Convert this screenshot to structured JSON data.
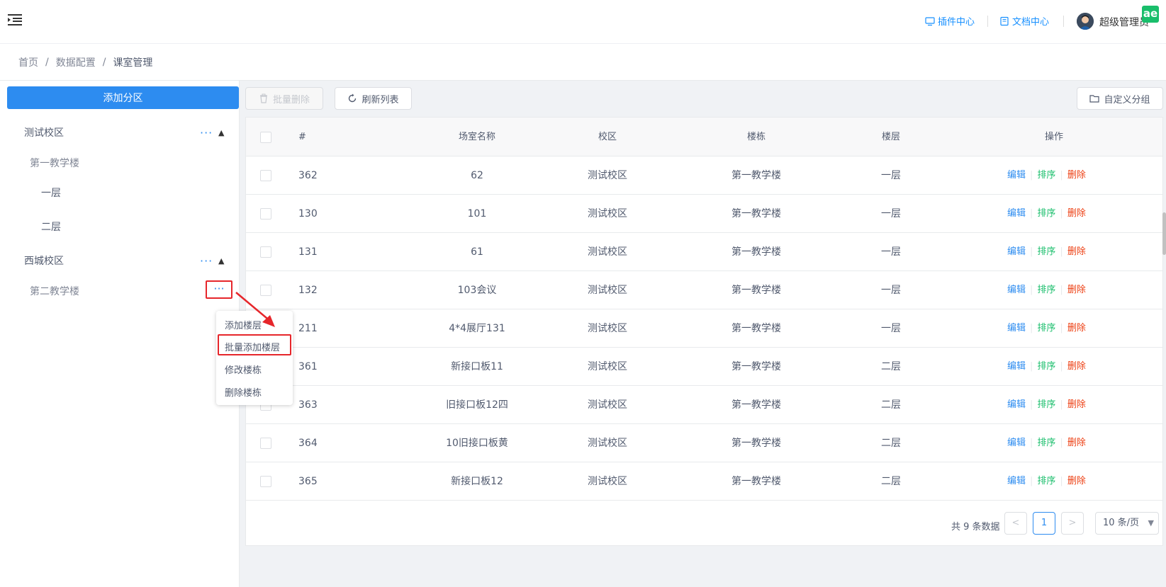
{
  "header": {
    "plugin_center": "插件中心",
    "doc_center": "文档中心",
    "user_name": "超级管理员",
    "corner_badge": "ae"
  },
  "breadcrumb": [
    "首页",
    "数据配置",
    "课室管理"
  ],
  "sidebar": {
    "add_zone_label": "添加分区",
    "more_glyph": "···",
    "tree": [
      {
        "label": "测试校区",
        "level": 0
      },
      {
        "label": "第一教学楼",
        "level": 1
      },
      {
        "label": "一层",
        "level": 2
      },
      {
        "label": "二层",
        "level": 2
      },
      {
        "label": "西城校区",
        "level": 0
      },
      {
        "label": "第二教学楼",
        "level": 1
      }
    ]
  },
  "dropdown": {
    "items": [
      "添加楼层",
      "批量添加楼层",
      "修改楼栋",
      "删除楼栋"
    ]
  },
  "toolbar": {
    "batch_delete": "批量删除",
    "refresh": "刷新列表",
    "custom_group": "自定义分组"
  },
  "table": {
    "headers": [
      "#",
      "场室名称",
      "校区",
      "楼栋",
      "楼层",
      "操作"
    ],
    "rows": [
      {
        "id": "362",
        "name": "62",
        "campus": "测试校区",
        "building": "第一教学楼",
        "floor": "一层"
      },
      {
        "id": "130",
        "name": "101",
        "campus": "测试校区",
        "building": "第一教学楼",
        "floor": "一层"
      },
      {
        "id": "131",
        "name": "61",
        "campus": "测试校区",
        "building": "第一教学楼",
        "floor": "一层"
      },
      {
        "id": "132",
        "name": "103会议",
        "campus": "测试校区",
        "building": "第一教学楼",
        "floor": "一层"
      },
      {
        "id": "211",
        "name": "4*4展厅131",
        "campus": "测试校区",
        "building": "第一教学楼",
        "floor": "一层"
      },
      {
        "id": "361",
        "name": "新接口板11",
        "campus": "测试校区",
        "building": "第一教学楼",
        "floor": "二层"
      },
      {
        "id": "363",
        "name": "旧接口板12四",
        "campus": "测试校区",
        "building": "第一教学楼",
        "floor": "二层"
      },
      {
        "id": "364",
        "name": "10旧接口板黄",
        "campus": "测试校区",
        "building": "第一教学楼",
        "floor": "二层"
      },
      {
        "id": "365",
        "name": "新接口板12",
        "campus": "测试校区",
        "building": "第一教学楼",
        "floor": "二层"
      }
    ],
    "actions": {
      "edit": "编辑",
      "sort": "排序",
      "delete": "删除"
    }
  },
  "pagination": {
    "total_text": "共 9 条数据",
    "current_page": "1",
    "page_size": "10 条/页"
  },
  "colors": {
    "primary": "#2d8cf0",
    "success": "#19be6b",
    "danger": "#ed4014",
    "annotation": "#e6262b"
  }
}
